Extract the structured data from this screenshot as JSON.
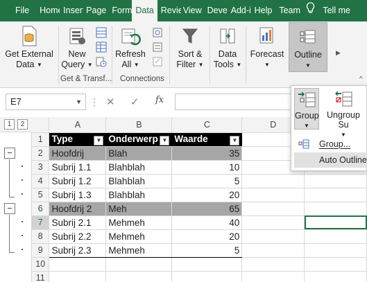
{
  "tabs": [
    {
      "label": "File",
      "active": false
    },
    {
      "label": "Home",
      "active": false
    },
    {
      "label": "Insert",
      "active": false
    },
    {
      "label": "Page",
      "active": false
    },
    {
      "label": "Formulas",
      "active": false
    },
    {
      "label": "Data",
      "active": true
    },
    {
      "label": "Review",
      "active": false
    },
    {
      "label": "View",
      "active": false
    },
    {
      "label": "Developer",
      "active": false
    },
    {
      "label": "Add-ins",
      "active": false
    },
    {
      "label": "Help",
      "active": false
    },
    {
      "label": "Team",
      "active": false
    }
  ],
  "tabbar": {
    "tell_me": "Tell me"
  },
  "ribbon": {
    "get_external_data": [
      "Get External",
      "Data"
    ],
    "new_query": [
      "New",
      "Query"
    ],
    "get_transform_label": "Get & Transf...",
    "refresh_all": [
      "Refresh",
      "All"
    ],
    "connections_label": "Connections",
    "sort_filter": [
      "Sort &",
      "Filter"
    ],
    "data_tools": [
      "Data",
      "Tools"
    ],
    "forecast": "Forecast",
    "outline": "Outline"
  },
  "formula_bar": {
    "name_box": "E7",
    "formula": ""
  },
  "outline": {
    "levels": [
      "1",
      "2"
    ]
  },
  "sheet": {
    "columns": [
      "A",
      "B",
      "C",
      "D"
    ],
    "header": {
      "row": "1",
      "cells": [
        "Type",
        "Onderwerp",
        "Waarde"
      ]
    },
    "rows": [
      {
        "row": "2",
        "cells": [
          "Hoofdrij",
          "Blah",
          "35"
        ]
      },
      {
        "row": "3",
        "cells": [
          "Subrij 1.1",
          "Blahblah",
          "10"
        ]
      },
      {
        "row": "4",
        "cells": [
          "Subrij 1.2",
          "Blahblah",
          "5"
        ]
      },
      {
        "row": "5",
        "cells": [
          "Subrij 1.3",
          "Blahblah",
          "20"
        ]
      },
      {
        "row": "6",
        "cells": [
          "Hoofdrij 2",
          "Meh",
          "65"
        ]
      },
      {
        "row": "7",
        "cells": [
          "Subrij 2.1",
          "Mehmeh",
          "40"
        ]
      },
      {
        "row": "8",
        "cells": [
          "Subrij 2.2",
          "Mehmeh",
          "20"
        ]
      },
      {
        "row": "9",
        "cells": [
          "Subrij 2.3",
          "Mehmeh",
          "5"
        ]
      },
      {
        "row": "10",
        "cells": [
          "",
          "",
          ""
        ]
      },
      {
        "row": "11",
        "cells": [
          "",
          "",
          ""
        ]
      }
    ]
  },
  "outline_panel": {
    "group": "Group",
    "ungroup": "Ungroup",
    "subtotal_clip": "Su",
    "menu": [
      "Group...",
      "Auto Outline"
    ]
  },
  "colors": {
    "brand": "#217346",
    "header_row": "#000000",
    "highlight_row": "#a6a6a6"
  }
}
